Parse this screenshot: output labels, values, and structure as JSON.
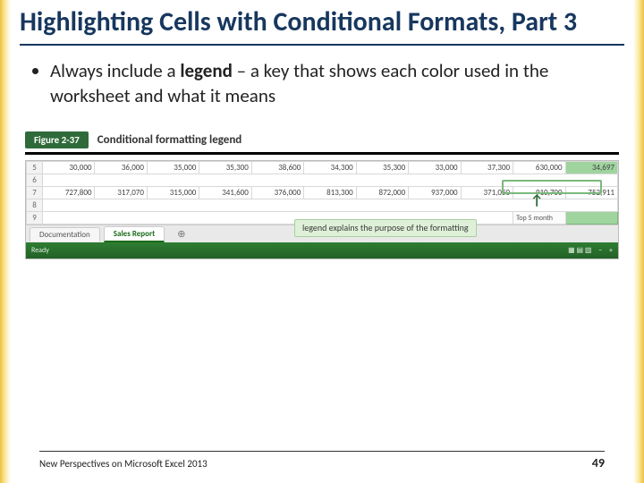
{
  "title": "Highlighting Cells with Conditional Formats, Part 3",
  "bullet": {
    "pre": "Always include a ",
    "bold": "legend",
    "post": " – a key that shows each color used in the worksheet and what it means"
  },
  "figure": {
    "tag": "Figure 2-37",
    "caption": "Conditional formatting legend",
    "row_labels": [
      "5",
      "6",
      "7",
      "8",
      "9"
    ],
    "row5": [
      "30,000",
      "36,000",
      "35,000",
      "35,300",
      "38,600",
      "34,300",
      "35,300",
      "33,000",
      "37,300",
      "630,000",
      "34,697"
    ],
    "row7": [
      "727,800",
      "317,070",
      "315,000",
      "341,600",
      "376,000",
      "813,300",
      "872,000",
      "937,000",
      "371,050",
      "910,700",
      "752,911"
    ],
    "legend_label": "Top 5 month",
    "legend_swatch": "light green",
    "callout": "legend explains the\npurpose of the formatting",
    "tabs": {
      "doc": "Documentation",
      "active": "Sales Report",
      "add": "⊕"
    },
    "statusbar": {
      "ready": "Ready",
      "views": "▦ ▤ ▧",
      "zoom_minus": "−",
      "zoom_plus": "+"
    }
  },
  "footer": {
    "text": "New Perspectives on Microsoft Excel 2013",
    "page": "49"
  }
}
